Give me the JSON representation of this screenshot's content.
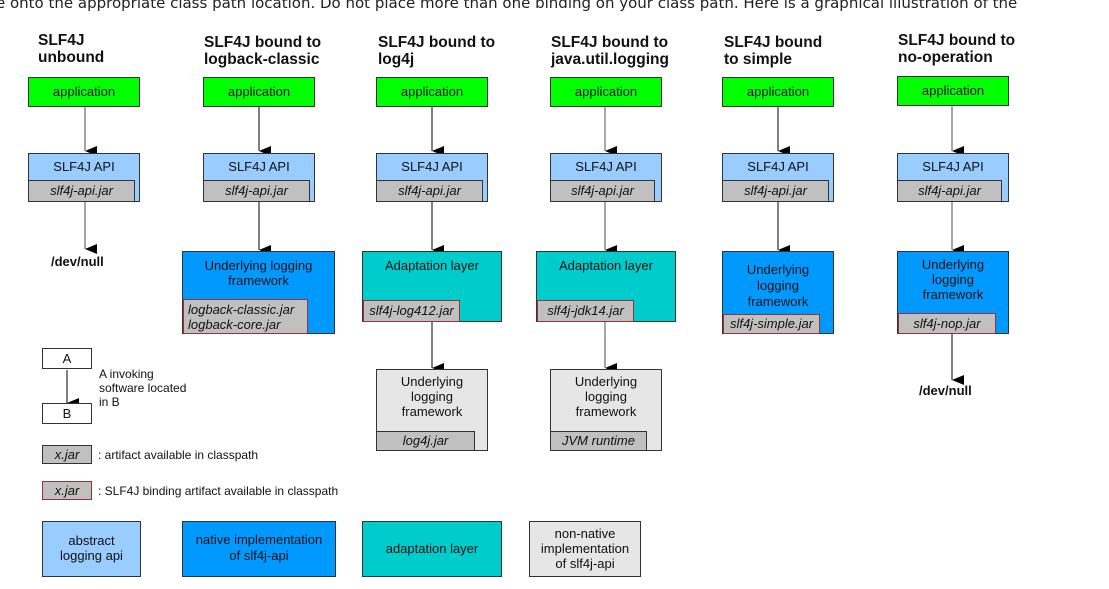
{
  "intro_text": "e onto the appropriate class path location. Do not place more than one binding on your class path. Here is a graphical illustration of the",
  "columns": [
    {
      "title_line1": "SLF4J",
      "title_line2": "unbound",
      "application": "application",
      "api_label": "SLF4J API",
      "api_jar": "slf4j-api.jar",
      "terminal": "/dev/null"
    },
    {
      "title_line1": "SLF4J bound to",
      "title_line2": "logback-classic",
      "application": "application",
      "api_label": "SLF4J API",
      "api_jar": "slf4j-api.jar",
      "impl_label_line1": "Underlying logging",
      "impl_label_line2": "framework",
      "binding_jar_line1": "logback-classic.jar",
      "binding_jar_line2": "logback-core.jar"
    },
    {
      "title_line1": "SLF4J bound to",
      "title_line2": "log4j",
      "application": "application",
      "api_label": "SLF4J API",
      "api_jar": "slf4j-api.jar",
      "adapt_label": "Adaptation layer",
      "binding_jar": "slf4j-log412.jar",
      "framework_line1": "Underlying",
      "framework_line2": "logging",
      "framework_line3": "framework",
      "framework_jar": "log4j.jar"
    },
    {
      "title_line1": "SLF4J bound to",
      "title_line2": "java.util.logging",
      "application": "application",
      "api_label": "SLF4J API",
      "api_jar": "slf4j-api.jar",
      "adapt_label": "Adaptation layer",
      "binding_jar": "slf4j-jdk14.jar",
      "framework_line1": "Underlying",
      "framework_line2": "logging",
      "framework_line3": "framework",
      "framework_jar": "JVM runtime"
    },
    {
      "title_line1": "SLF4J bound",
      "title_line2": "to simple",
      "application": "application",
      "api_label": "SLF4J API",
      "api_jar": "slf4j-api.jar",
      "impl_line1": "Underlying",
      "impl_line2": "logging",
      "impl_line3": "framework",
      "binding_jar": "slf4j-simple.jar"
    },
    {
      "title_line1": "SLF4J bound to",
      "title_line2": "no-operation",
      "application": "application",
      "api_label": "SLF4J API",
      "api_jar": "slf4j-api.jar",
      "impl_line1": "Underlying",
      "impl_line2": "logging",
      "impl_line3": "framework",
      "binding_jar": "slf4j-nop.jar",
      "terminal": "/dev/null"
    }
  ],
  "legend": {
    "box_a": "A",
    "box_b": "B",
    "invoke_line1": "A invoking",
    "invoke_line2": "software located",
    "invoke_line3": "in B",
    "artifact_jar": "x.jar",
    "artifact_desc": ": artifact available in classpath",
    "binding_jar": "x.jar",
    "binding_desc": ": SLF4J binding artifact available in classpath",
    "swatches": [
      {
        "line1": "abstract",
        "line2": "logging api",
        "color": "#99ccff"
      },
      {
        "line1": "native implementation",
        "line2": "of slf4j-api",
        "color": "#0099ff"
      },
      {
        "line1": "adaptation layer",
        "color": "#00cccc"
      },
      {
        "line1": "non-native",
        "line2": "implementation",
        "line3": "of slf4j-api",
        "color": "#e6e6e6"
      }
    ]
  },
  "colors": {
    "application": "#00ff00",
    "api": "#99ccff",
    "native": "#0099ff",
    "adaptation": "#00cccc",
    "non_native": "#e6e6e6",
    "jar": "#c0c0c0",
    "binding_border": "#993333"
  }
}
